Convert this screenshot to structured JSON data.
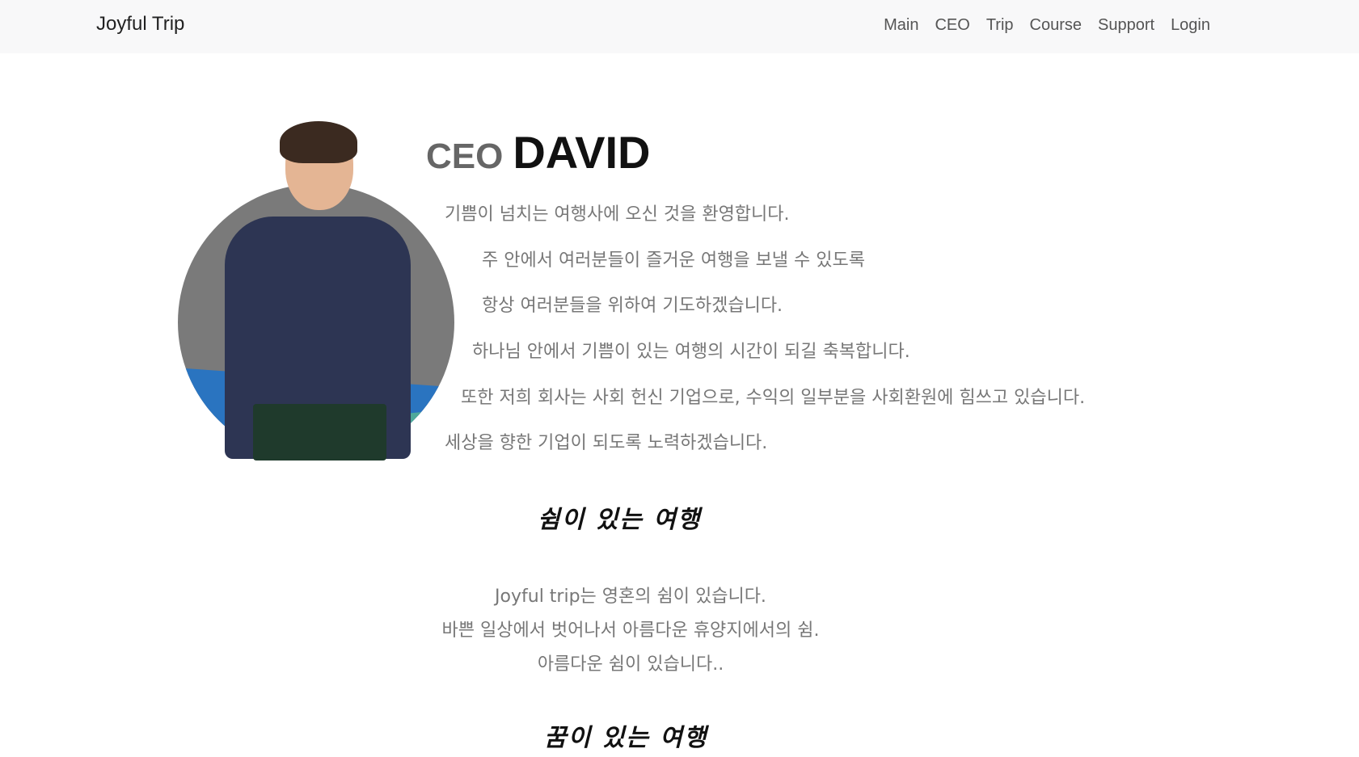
{
  "navbar": {
    "brand": "Joyful Trip",
    "links": [
      "Main",
      "CEO",
      "Trip",
      "Course",
      "Support",
      "Login"
    ]
  },
  "profile": {
    "photo_icon": "ceo-portrait",
    "title_label": "CEO",
    "name": "DAVID"
  },
  "intro": {
    "lines": [
      "기쁨이 넘치는 여행사에 오신 것을 환영합니다.",
      "주 안에서 여러분들이 즐거운 여행을 보낼 수 있도록",
      "항상 여러분들을 위하여 기도하겠습니다.",
      "하나님 안에서 기쁨이 있는 여행의 시간이 되길 축복합니다.",
      "또한 저희 회사는 사회 헌신 기업으로, 수익의 일부분을 사회환원에 힘쓰고 있습니다.",
      "세상을 향한 기업이 되도록 노력하겠습니다."
    ]
  },
  "sections": [
    {
      "heading": "쉼이 있는 여행",
      "lines": [
        "Joyful trip는 영혼의 쉼이 있습니다.",
        "바쁜 일상에서 벗어나서 아름다운 휴양지에서의 쉼.",
        "아름다운 쉼이 있습니다.."
      ]
    },
    {
      "heading": "꿈이 있는 여행"
    }
  ]
}
